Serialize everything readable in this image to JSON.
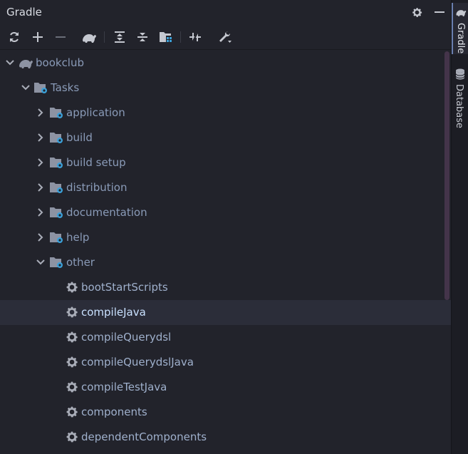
{
  "header": {
    "title": "Gradle"
  },
  "toolbar": {
    "buttons": [
      "refresh-icon",
      "add-icon",
      "remove-icon",
      "gradle-elephant-icon",
      "expand-all-icon",
      "collapse-all-icon",
      "group-modules-icon",
      "toggle-offline-icon",
      "build-tool-settings-icon"
    ]
  },
  "tree": {
    "project": "bookclub",
    "tasks_folder": "Tasks",
    "groups": [
      "application",
      "build",
      "build setup",
      "distribution",
      "documentation",
      "help",
      "other"
    ],
    "tasks": [
      "bootStartScripts",
      "compileJava",
      "compileQuerydsl",
      "compileQuerydslJava",
      "compileTestJava",
      "components",
      "dependentComponents"
    ],
    "selected_task": "compileJava"
  },
  "rightbar": {
    "tabs": [
      {
        "label": "Gradle",
        "icon": "gradle-elephant-icon",
        "active": true
      },
      {
        "label": "Database",
        "icon": "database-icon",
        "active": false
      }
    ]
  },
  "colors": {
    "background": "#22232b",
    "selected_row": "#2b2d39",
    "label": "#8a9bb8",
    "accent": "#3ba0d8"
  }
}
